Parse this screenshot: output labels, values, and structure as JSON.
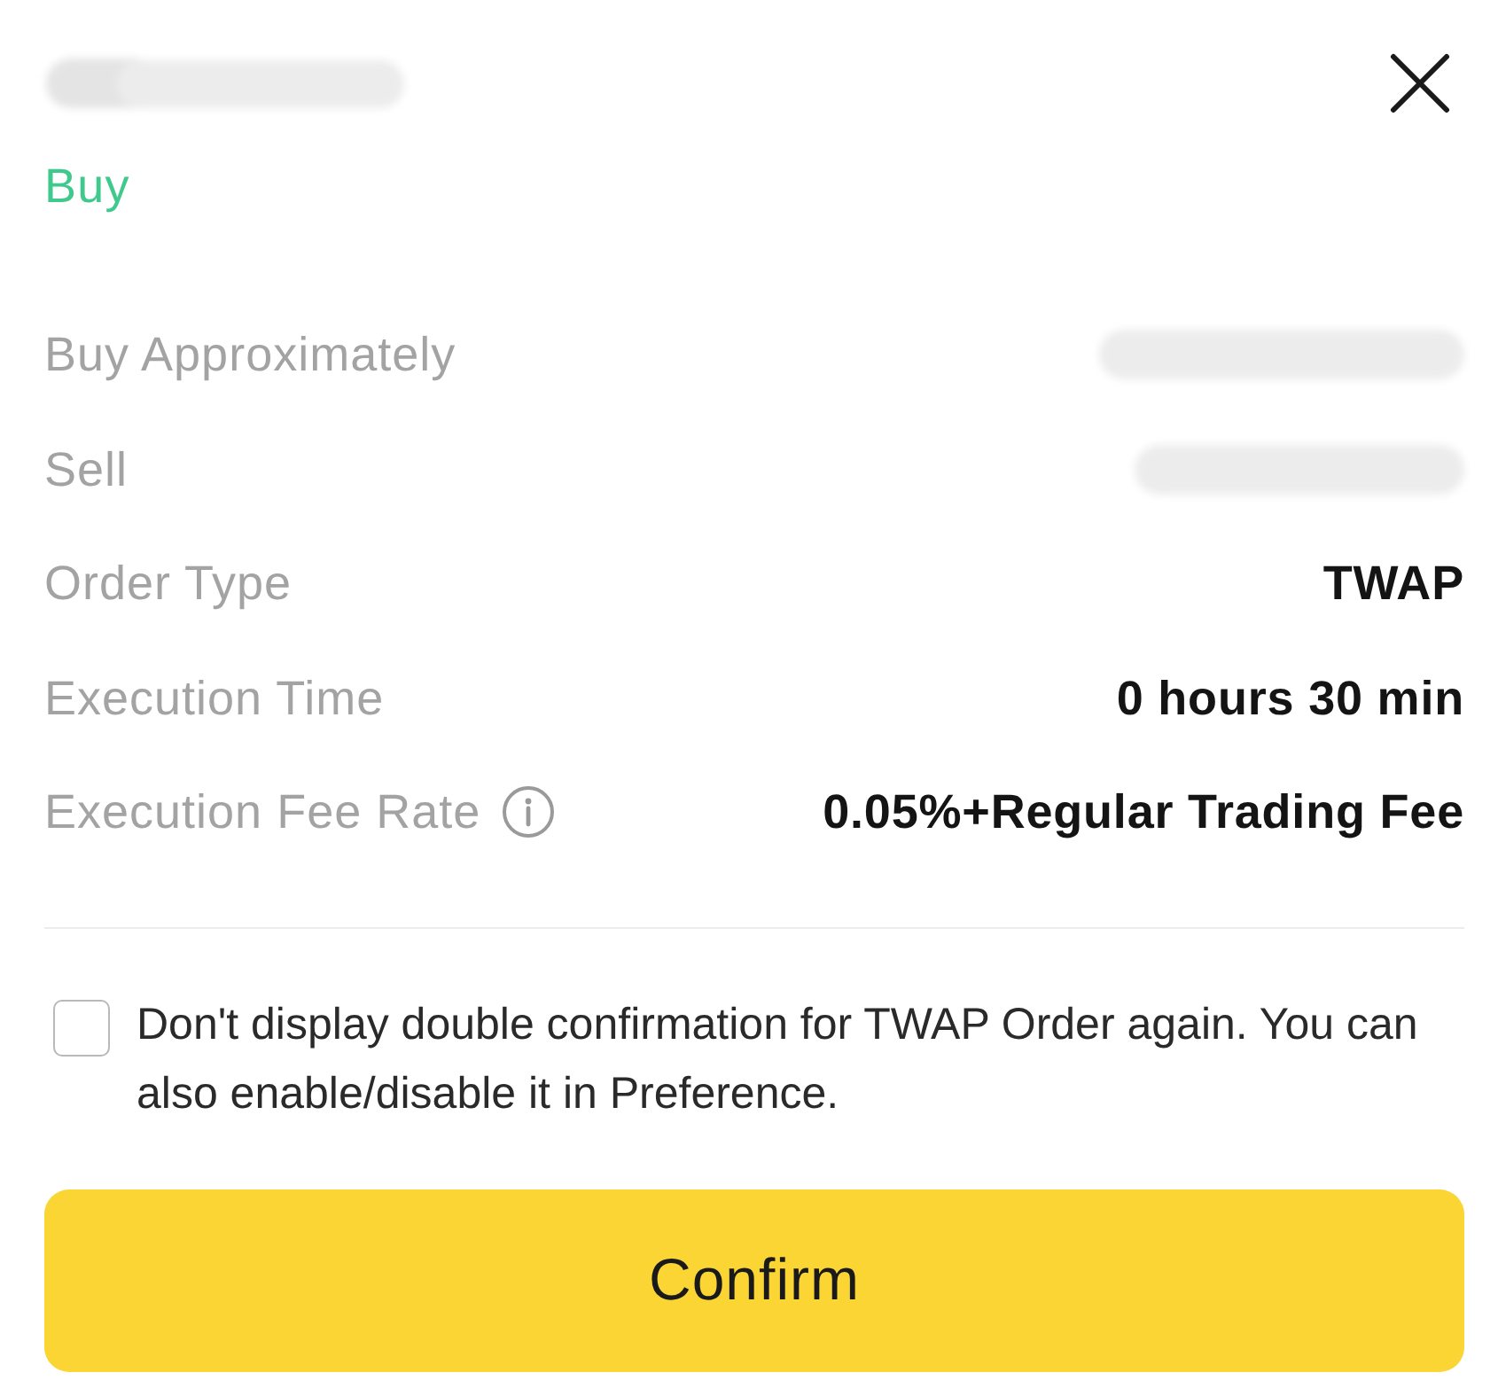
{
  "header": {
    "title": {
      "redacted": true
    },
    "side": "Buy"
  },
  "rows": [
    {
      "label": "Buy Approximately",
      "kind": "redacted",
      "info": false
    },
    {
      "label": "Sell",
      "kind": "redacted",
      "info": false
    },
    {
      "label": "Order Type",
      "kind": "text",
      "value": "TWAP",
      "info": false
    },
    {
      "label": "Execution Time",
      "kind": "text",
      "value": "0 hours 30 min",
      "info": false
    },
    {
      "label": "Execution Fee Rate",
      "kind": "text",
      "value": "0.05%+Regular Trading Fee",
      "info": true
    }
  ],
  "preference": {
    "checked": false,
    "label": "Don't display double confirmation for TWAP Order again. You can also enable/disable it in Preference."
  },
  "confirm_button": {
    "label": "Confirm"
  }
}
